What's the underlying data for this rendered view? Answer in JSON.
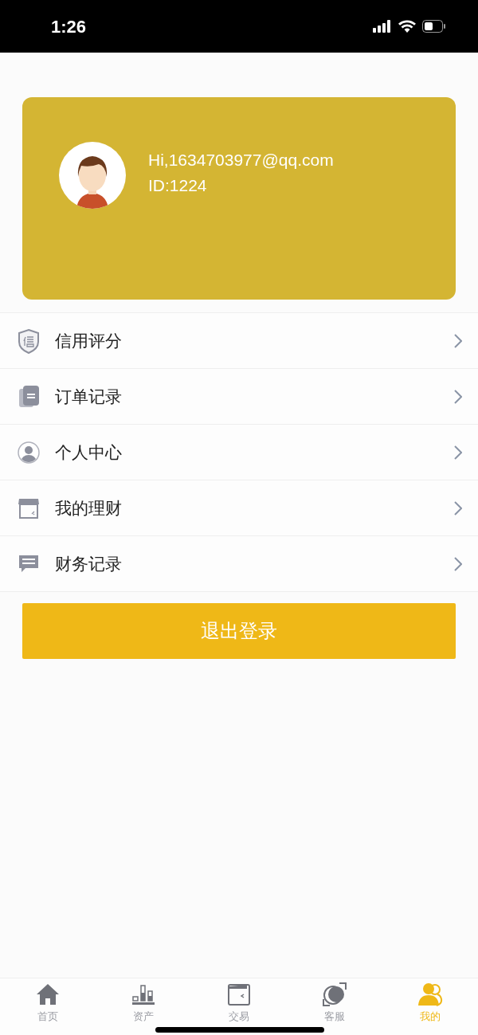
{
  "status_bar": {
    "time": "1:26"
  },
  "profile": {
    "greeting": "Hi,1634703977@qq.com",
    "id": "ID:1224"
  },
  "menu": [
    {
      "kind": "shield",
      "label": "信用评分"
    },
    {
      "kind": "document",
      "label": "订单记录"
    },
    {
      "kind": "person",
      "label": "个人中心"
    },
    {
      "kind": "shop",
      "label": "我的理财"
    },
    {
      "kind": "message",
      "label": "财务记录"
    }
  ],
  "logout_button": "退出登录",
  "tab_bar": [
    {
      "kind": "home",
      "label": "首页",
      "selected": false
    },
    {
      "kind": "chart",
      "label": "资产",
      "selected": false
    },
    {
      "kind": "wallet",
      "label": "交易",
      "selected": false
    },
    {
      "kind": "support",
      "label": "客服",
      "selected": false
    },
    {
      "kind": "user",
      "label": "我的",
      "selected": true
    }
  ]
}
